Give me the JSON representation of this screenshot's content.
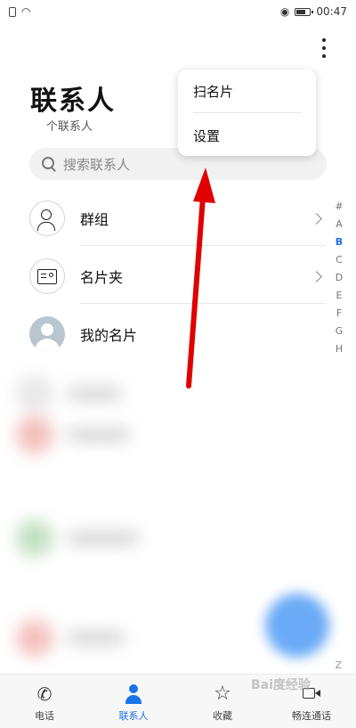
{
  "status_bar": {
    "time": "00:47"
  },
  "header": {
    "title": "联系人",
    "subtitle": "个联系人"
  },
  "search": {
    "placeholder": "搜索联系人"
  },
  "rows": [
    {
      "label": "群组"
    },
    {
      "label": "名片夹"
    },
    {
      "label": "我的名片"
    }
  ],
  "menu": {
    "items": [
      {
        "label": "扫名片"
      },
      {
        "label": "设置"
      }
    ]
  },
  "alpha_index": [
    "#",
    "A",
    "B",
    "C",
    "D",
    "E",
    "F",
    "G",
    "H"
  ],
  "alpha_active": "B",
  "alpha_last": "Z",
  "bottom_nav": [
    {
      "label": "电话",
      "icon": "phone-icon"
    },
    {
      "label": "联系人",
      "icon": "contacts-icon",
      "active": true
    },
    {
      "label": "收藏",
      "icon": "star-icon"
    },
    {
      "label": "畅连通话",
      "icon": "video-call-icon"
    }
  ],
  "watermark": "Bai度经验",
  "colors": {
    "accent": "#1a73e8",
    "arrow": "#e00000",
    "fab": "#6aaaf6"
  }
}
